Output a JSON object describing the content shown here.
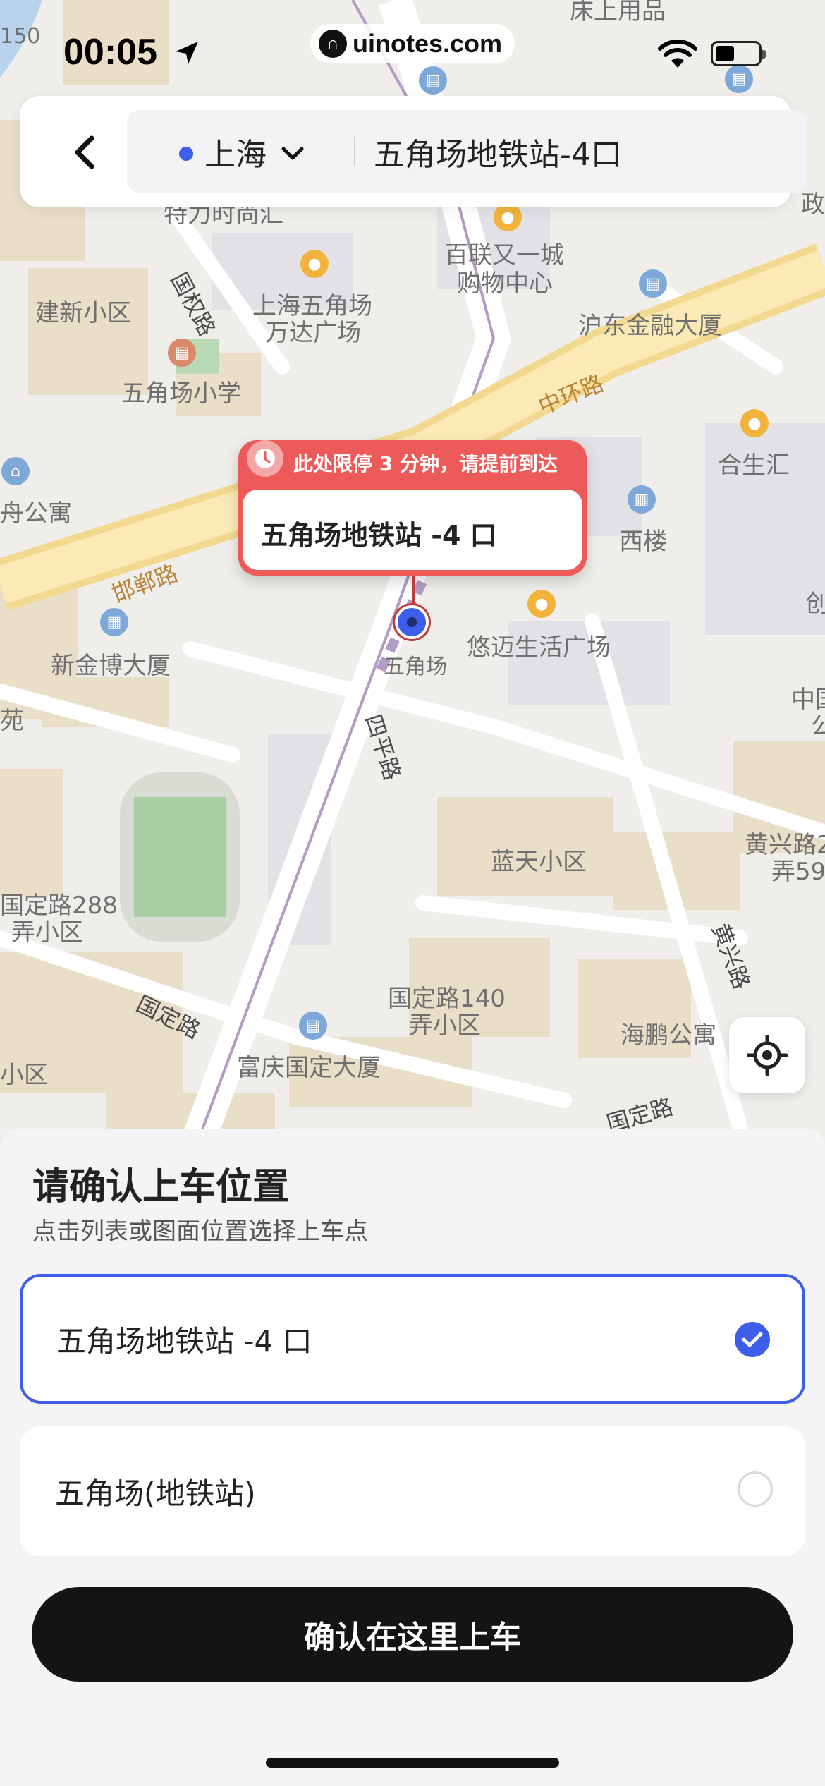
{
  "status_bar": {
    "time": "00:05",
    "watermark": "uinotes.com"
  },
  "header": {
    "city": "上海",
    "search_value": "五角场地铁站-4口",
    "accent_color": "#3d5ee8"
  },
  "map": {
    "labels": {
      "chuangshang": "床上用品",
      "tedao": "特力时尚汇",
      "guoquan_road": "国权路",
      "jianxin": "建新小区",
      "wanda1": "上海五角场",
      "wanda2": "万达广场",
      "bailian1": "百联又一城",
      "bailian2": "购物中心",
      "hudong": "沪东金融大厦",
      "zheng": "政",
      "wjc_school": "五角场小学",
      "zhonghuan": "中环路",
      "hesheng": "合生汇",
      "gongyu": "舟公寓",
      "xilou": "西楼",
      "handan": "邯郸路",
      "chuang": "创",
      "xinjinbo": "新金博大厦",
      "youmai": "悠迈生活广场",
      "wjc_station": "五角场",
      "siping": "四平路",
      "yuan": "苑",
      "zhongguo1": "中国",
      "zhongguo2": "公",
      "lantian": "蓝天小区",
      "huangxing_a": "黄兴路2",
      "huangxing_b": "弄59",
      "gd288a": "国定路288",
      "gd288b": "弄小区",
      "huangxing_road": "黄兴路",
      "guoding_road1": "国定路",
      "gd140a": "国定路140",
      "gd140b": "弄小区",
      "haipeng": "海鹏公寓",
      "xiaoqu": "小区",
      "fuqing": "富庆国定大厦",
      "guoding_road2": "国定路",
      "top150": "150"
    }
  },
  "callout": {
    "notice": "此处限停 3 分钟，请提前到达",
    "name": "五角场地铁站 -4 口"
  },
  "sheet": {
    "title": "请确认上车位置",
    "subtitle": "点击列表或图面位置选择上车点",
    "options": [
      {
        "label": "五角场地铁站 -4 口",
        "selected": true
      },
      {
        "label": "五角场(地铁站)",
        "selected": false
      }
    ],
    "confirm_label": "确认在这里上车"
  }
}
